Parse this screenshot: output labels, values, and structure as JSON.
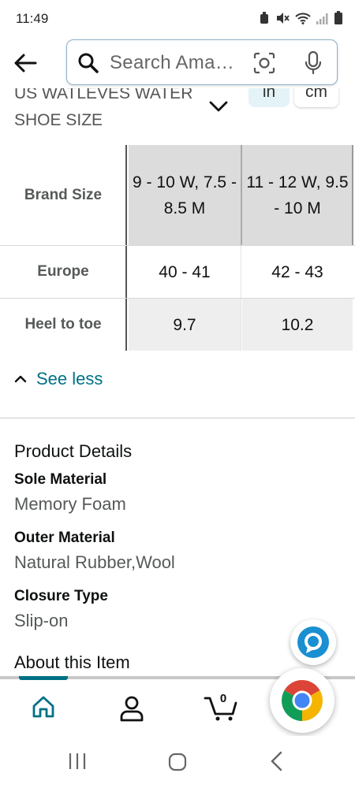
{
  "status_bar": {
    "time": "11:49"
  },
  "search": {
    "placeholder": "Search Ama…"
  },
  "size_chart": {
    "heading": "US WATLEVES WATER SHOE SIZE",
    "unit_in": "in",
    "unit_cm": "cm",
    "rows": [
      {
        "label": "Brand Size",
        "cells": [
          "9 - 10 W, 7.5 - 8.5 M",
          "11 - 12 W, 9.5 - 10 M"
        ]
      },
      {
        "label": "Europe",
        "cells": [
          "40 - 41",
          "42 - 43"
        ]
      },
      {
        "label": "Heel to toe",
        "cells": [
          "9.7",
          "10.2"
        ]
      }
    ],
    "see_less": "See less"
  },
  "product_details": {
    "title": "Product Details",
    "attributes": [
      {
        "name": "Sole Material",
        "value": "Memory Foam"
      },
      {
        "name": "Outer Material",
        "value": "Natural Rubber,Wool"
      },
      {
        "name": "Closure Type",
        "value": "Slip-on"
      }
    ]
  },
  "about": {
    "title": "About this Item"
  },
  "bottom_nav": {
    "cart_count": "0"
  },
  "colors": {
    "accent": "#007185",
    "link": "#007185",
    "unit_active_bg": "#e3f3f7",
    "alexa_blue": "#1a8fd1"
  },
  "icons": [
    "back-arrow-icon",
    "search-icon",
    "camera-lens-icon",
    "mic-icon",
    "chevron-down-icon",
    "chevron-up-icon",
    "alexa-icon",
    "home-icon",
    "account-icon",
    "cart-icon",
    "chrome-icon",
    "recent-apps-icon",
    "home-circle-icon",
    "back-chevron-icon"
  ]
}
